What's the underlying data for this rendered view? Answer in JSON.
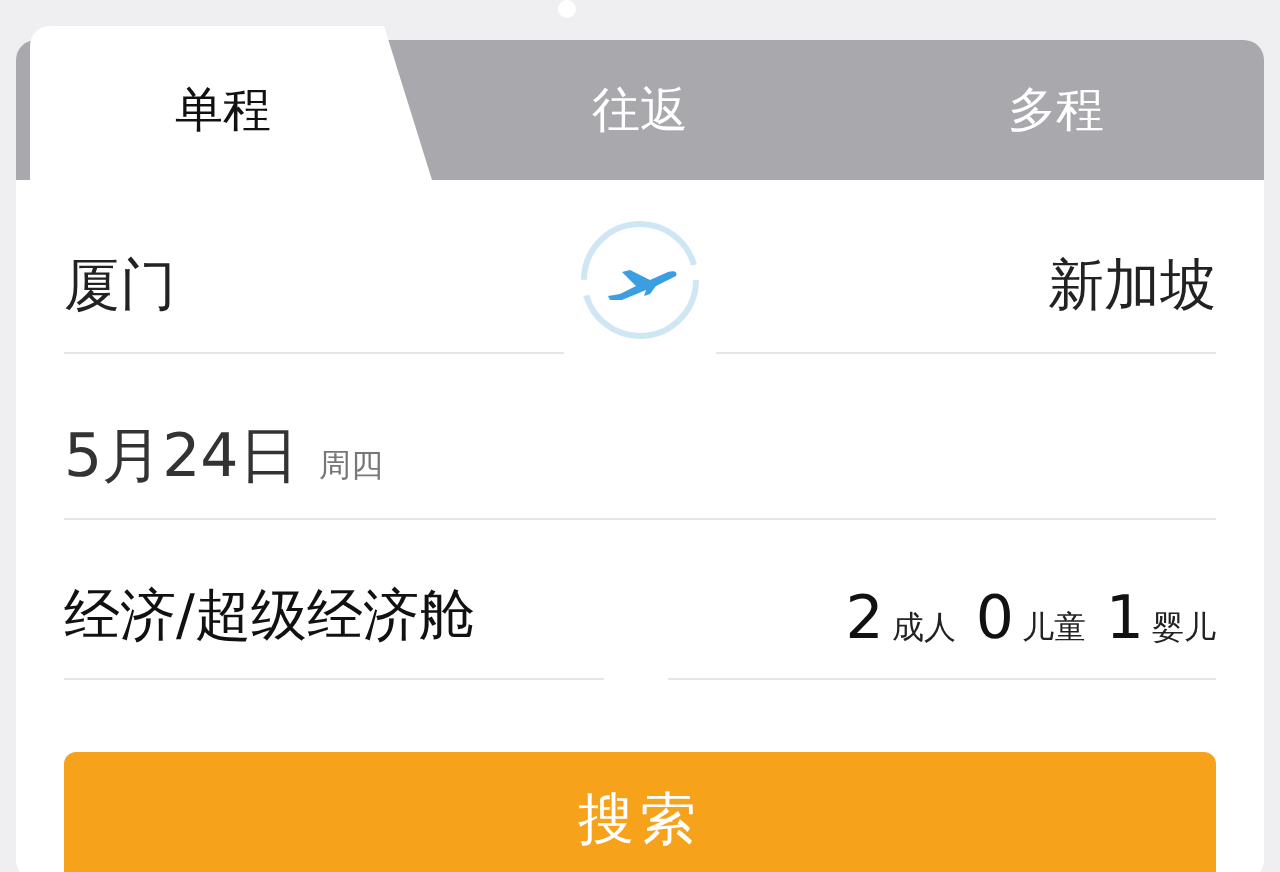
{
  "tabs": [
    {
      "label": "单程",
      "selected": true
    },
    {
      "label": "往返",
      "selected": false
    },
    {
      "label": "多程",
      "selected": false
    }
  ],
  "route": {
    "from": "厦门",
    "to": "新加坡"
  },
  "date": {
    "day": "5月24日",
    "weekday": "周四"
  },
  "cabin": "经济/超级经济舱",
  "passengers": [
    {
      "count": "2",
      "label": "成人"
    },
    {
      "count": "0",
      "label": "儿童"
    },
    {
      "count": "1",
      "label": "婴儿"
    }
  ],
  "search_button": "搜索"
}
